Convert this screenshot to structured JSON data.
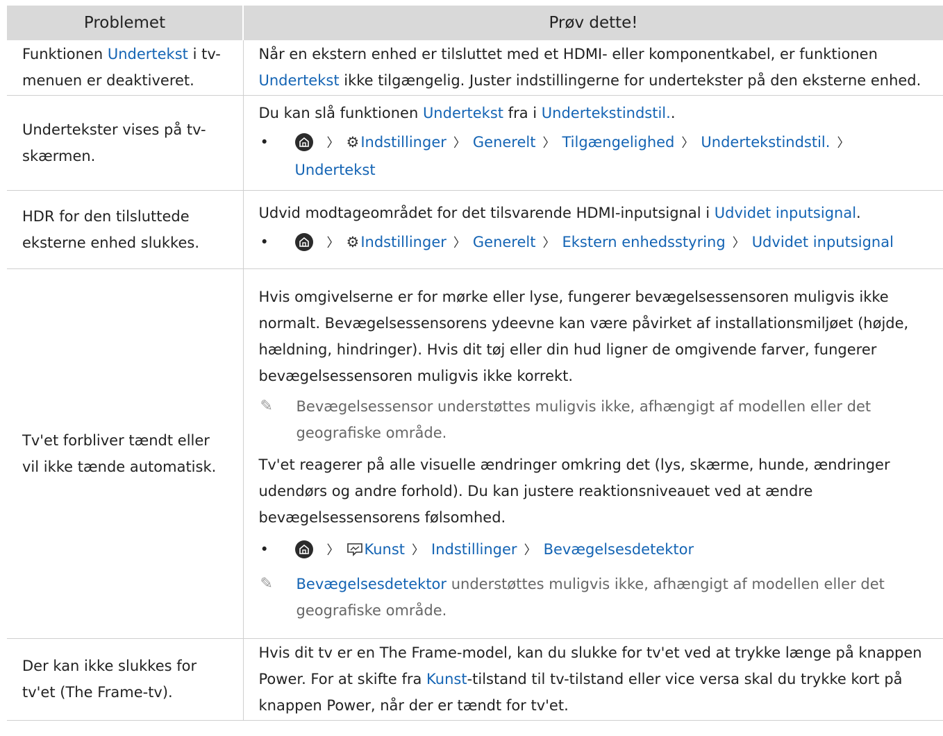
{
  "header": {
    "col1": "Problemet",
    "col2": "Prøv dette!"
  },
  "row1": {
    "problem_a": "Funktionen ",
    "problem_link": "Undertekst",
    "problem_b": " i tv-menuen er deaktiveret.",
    "sol_a": "Når en ekstern enhed er tilsluttet med et HDMI- eller komponentkabel, er funktionen ",
    "sol_link": "Undertekst",
    "sol_b": " ikke tilgængelig. Juster indstillingerne for undertekster på den eksterne enhed."
  },
  "row2": {
    "problem": "Undertekster vises på tv-skærmen.",
    "sol_a": "Du kan slå funktionen ",
    "sol_link1": "Undertekst",
    "sol_b": " fra i ",
    "sol_link2": "Undertekstindstil.",
    "sol_c": ".",
    "nav": [
      "Indstillinger",
      "Generelt",
      "Tilgængelighed",
      "Undertekstindstil.",
      "Undertekst"
    ]
  },
  "row3": {
    "problem": "HDR for den tilsluttede eksterne enhed slukkes.",
    "sol_a": "Udvid modtageområdet for det tilsvarende HDMI-inputsignal i ",
    "sol_link": "Udvidet inputsignal",
    "sol_b": ".",
    "nav": [
      "Indstillinger",
      "Generelt",
      "Ekstern enhedsstyring",
      "Udvidet inputsignal"
    ]
  },
  "row4": {
    "problem": "Tv'et forbliver tændt eller vil ikke tænde automatisk.",
    "para1": "Hvis omgivelserne er for mørke eller lyse, fungerer bevægelsessensoren muligvis ikke normalt. Bevægelsessensorens ydeevne kan være påvirket af installationsmiljøet (højde, hældning, hindringer). Hvis dit tøj eller din hud ligner de omgivende farver, fungerer bevægelsessensoren muligvis ikke korrekt.",
    "note1": "Bevægelsessensor understøttes muligvis ikke, afhængigt af modellen eller det geografiske område.",
    "para2": "Tv'et reagerer på alle visuelle ændringer omkring det (lys, skærme, hunde, ændringer udendørs og andre forhold). Du kan justere reaktionsniveauet ved at ændre bevægelsessensorens følsomhed.",
    "nav": [
      "Kunst",
      "Indstillinger",
      "Bevægelsesdetektor"
    ],
    "note2_link": "Bevægelsesdetektor",
    "note2_b": " understøttes muligvis ikke, afhængigt af modellen eller det geografiske område."
  },
  "row5": {
    "problem": "Der kan ikke slukkes for tv'et (The Frame-tv).",
    "sol_a": "Hvis dit tv er en The Frame-model, kan du slukke for tv'et ved at trykke længe på knappen Power. For at skifte fra ",
    "sol_link": "Kunst",
    "sol_b": "-tilstand til tv-tilstand eller vice versa skal du trykke kort på knappen Power, når der er tændt for tv'et."
  }
}
